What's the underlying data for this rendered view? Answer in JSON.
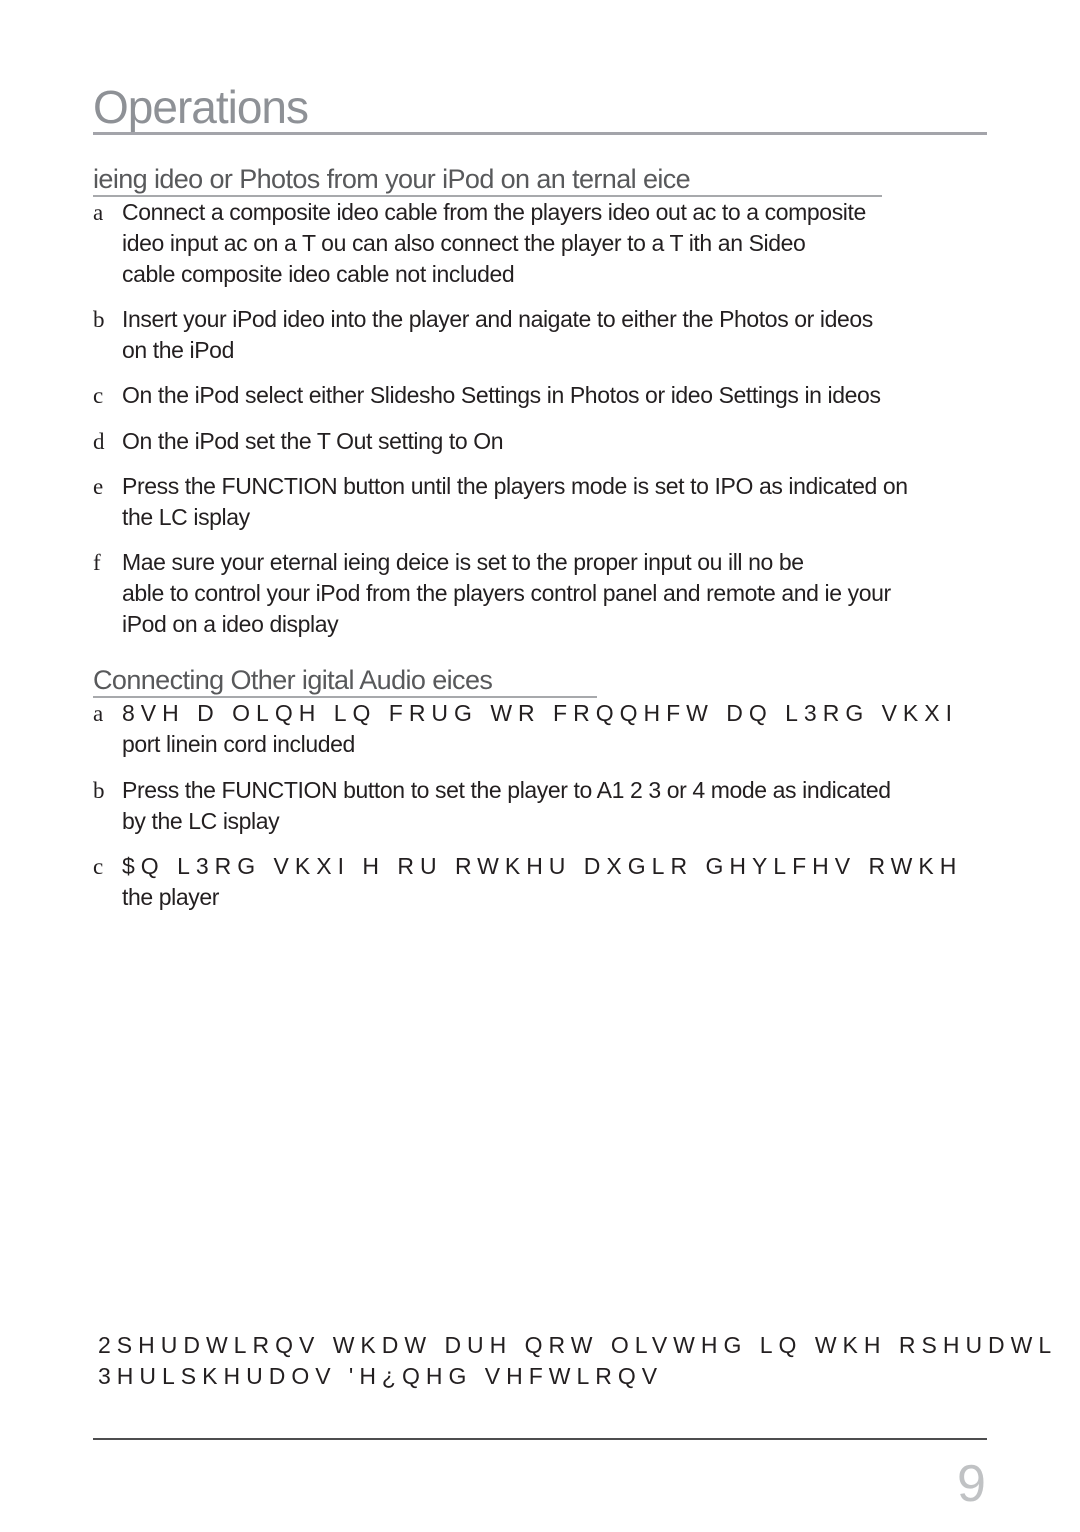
{
  "page": {
    "title": "Operations",
    "page_number": "9"
  },
  "sections": [
    {
      "heading": "ieing ideo or Photos from your iPod on an ternal eice",
      "steps": [
        {
          "letter": "a",
          "lines": [
            "Connect a composite ideo cable from the players ideo out ac to a composite",
            "ideo input ac on a T ou can also connect the player to a T ith an Sideo",
            "cable composite ideo cable not included"
          ]
        },
        {
          "letter": "b",
          "lines": [
            "Insert your iPod ideo into the player and naigate to either the Photos or ideos",
            "on the iPod"
          ]
        },
        {
          "letter": "c",
          "lines": [
            "On the iPod select either Slidesho Settings in Photos or ideo Settings in ideos"
          ]
        },
        {
          "letter": "d",
          "lines": [
            "On the iPod set the T Out setting to On"
          ]
        },
        {
          "letter": "e",
          "lines": [
            "Press the FUNCTION button until the players mode is set to IPO as indicated on",
            "the LC isplay"
          ]
        },
        {
          "letter": "f",
          "lines": [
            "Mae sure your eternal ieing deice is set to the proper input  ou ill no be",
            "able to control your iPod from the players control panel and remote and ie your",
            "iPod on a ideo display"
          ]
        }
      ]
    },
    {
      "heading": "Connecting Other igital Audio eices",
      "steps": [
        {
          "letter": "a",
          "lines": [
            "8VH D OLQH LQ FRUG WR FRQQHFW DQ L3RG VKXI",
            "port linein cord included"
          ]
        },
        {
          "letter": "b",
          "lines": [
            "Press the FUNCTION button to set the player to A1 2 3 or 4 mode as indicated",
            "by the LC isplay"
          ]
        },
        {
          "letter": "c",
          "lines": [
            "$Q L3RG VKXI H RU RWKHU DXGLR GHYLFHV RWKH",
            "the player"
          ]
        }
      ]
    }
  ],
  "note": {
    "lines": [
      "2SHUDWLRQV WKDW DUH QRW OLVWHG LQ WKH RSHUDWL",
      "3HULSKHUDOV 'H¿QHG VHFWLRQV"
    ]
  }
}
